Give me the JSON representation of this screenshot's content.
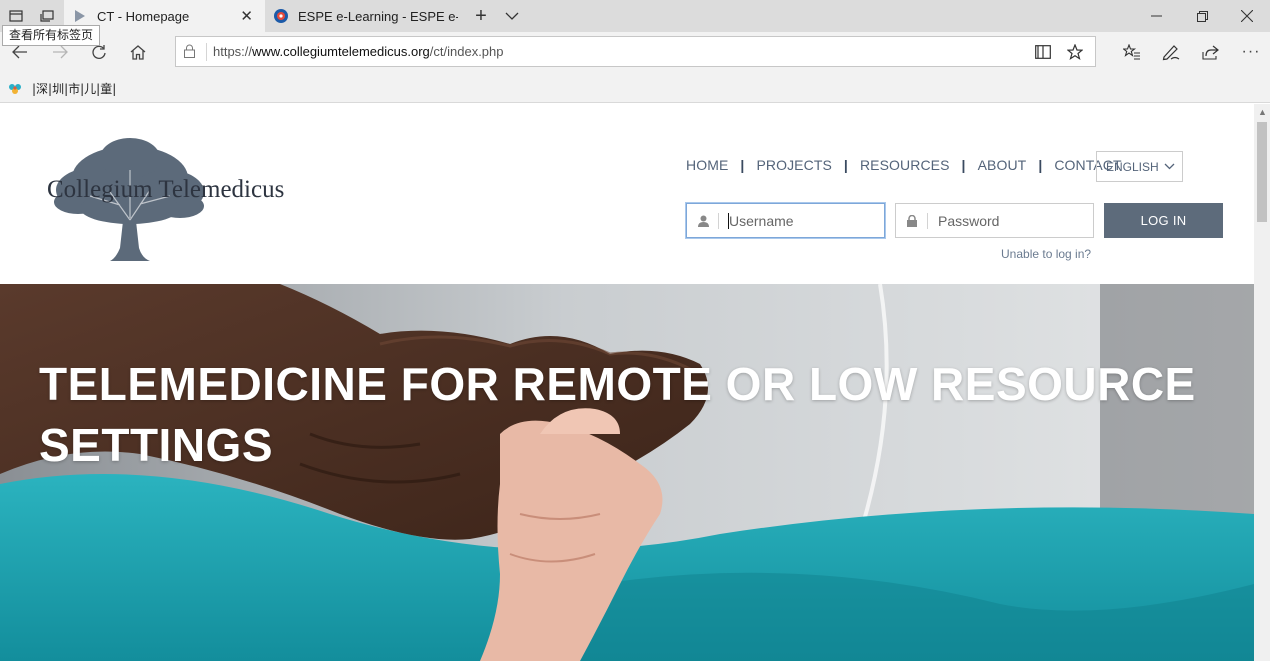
{
  "browser": {
    "tooltip": "查看所有标签页",
    "tabs": [
      {
        "title": "CT - Homepage",
        "active": true
      },
      {
        "title": "ESPE e-Learning - ESPE e-Le",
        "active": false
      }
    ],
    "url_prefix": "https://",
    "url_domain": "www.collegiumtelemedicus.org",
    "url_path": "/ct/index.php",
    "favorites": [
      {
        "label": "|深|圳|市|儿|童|",
        "icon": "flower-icon"
      }
    ]
  },
  "site": {
    "logo_text": "Collegium Telemedicus",
    "nav": [
      {
        "label": "HOME"
      },
      {
        "label": "PROJECTS"
      },
      {
        "label": "RESOURCES"
      },
      {
        "label": "ABOUT"
      },
      {
        "label": "CONTACT"
      }
    ],
    "language": "ENGLISH",
    "login": {
      "username_placeholder": "Username",
      "username_value": "",
      "password_placeholder": "Password",
      "password_value": "",
      "button_label": "LOG IN",
      "forgot_link": "Unable to log in?"
    },
    "hero": {
      "title": "TELEMEDICINE FOR REMOTE OR LOW RESOURCE SETTINGS"
    }
  },
  "colors": {
    "nav_text": "#54647a",
    "login_button": "#5d6b7b",
    "teal_blanket": "#1fa6b3",
    "tab_bar": "#dcdcdc"
  }
}
